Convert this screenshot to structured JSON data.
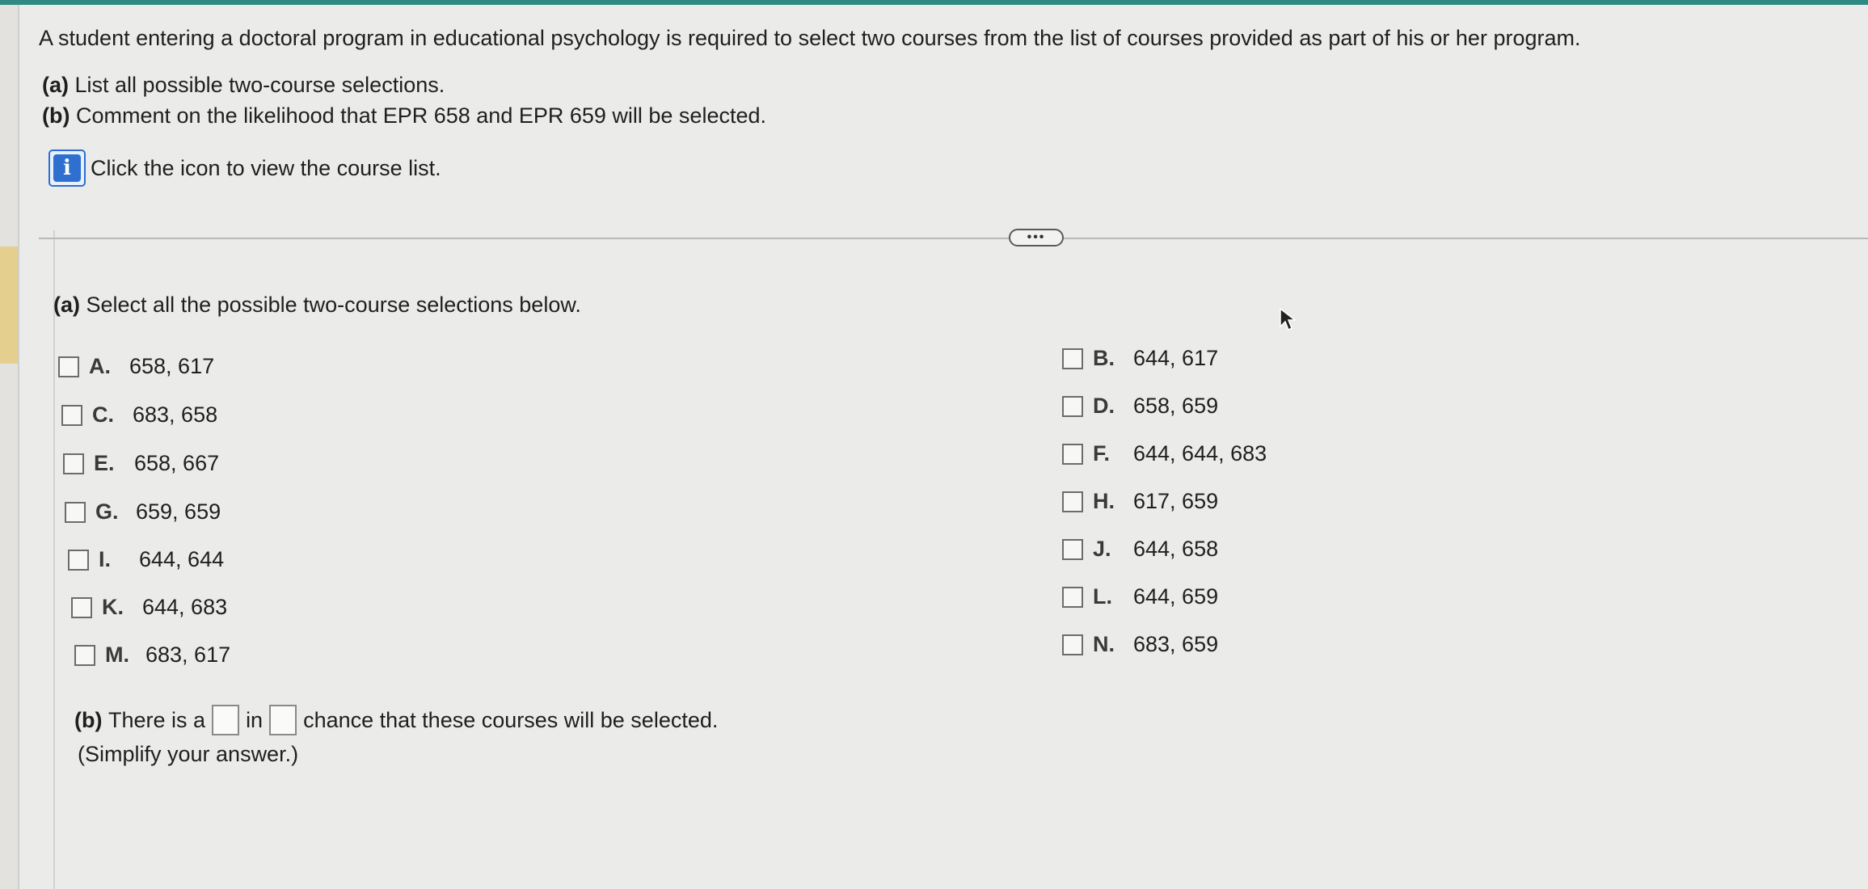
{
  "question": {
    "intro": "A student entering a doctoral program in educational psychology is required to select two courses from the list of courses provided as part of his or her program.",
    "parts": [
      {
        "label": "(a)",
        "text": "List all possible two-course selections."
      },
      {
        "label": "(b)",
        "text": "Comment on the likelihood that EPR 658 and EPR 659 will be selected."
      }
    ],
    "info_icon": "info-icon",
    "info_text": "Click the icon to view the course list."
  },
  "more_button": "more-dots-icon",
  "part_a": {
    "label": "(a)",
    "prompt": "Select all the possible two-course selections below.",
    "options_left": [
      {
        "letter": "A.",
        "value": "658, 617"
      },
      {
        "letter": "C.",
        "value": "683, 658"
      },
      {
        "letter": "E.",
        "value": "658, 667"
      },
      {
        "letter": "G.",
        "value": "659, 659"
      },
      {
        "letter": "I.",
        "value": "644, 644"
      },
      {
        "letter": "K.",
        "value": "644, 683"
      },
      {
        "letter": "M.",
        "value": "683, 617"
      }
    ],
    "options_right": [
      {
        "letter": "B.",
        "value": "644, 617"
      },
      {
        "letter": "D.",
        "value": "658, 659"
      },
      {
        "letter": "F.",
        "value": "644, 644, 683"
      },
      {
        "letter": "H.",
        "value": "617, 659"
      },
      {
        "letter": "J.",
        "value": "644, 658"
      },
      {
        "letter": "L.",
        "value": "644, 659"
      },
      {
        "letter": "N.",
        "value": "683, 659"
      }
    ]
  },
  "part_b": {
    "label": "(b)",
    "text_before": "There is a",
    "text_mid": "in",
    "text_after": "chance that these courses will be selected.",
    "hint": "(Simplify your answer.)",
    "input1_value": "",
    "input2_value": ""
  },
  "colors": {
    "accent": "#2f8a83",
    "info_blue": "#2f6fcf",
    "background": "#ebebe9"
  }
}
